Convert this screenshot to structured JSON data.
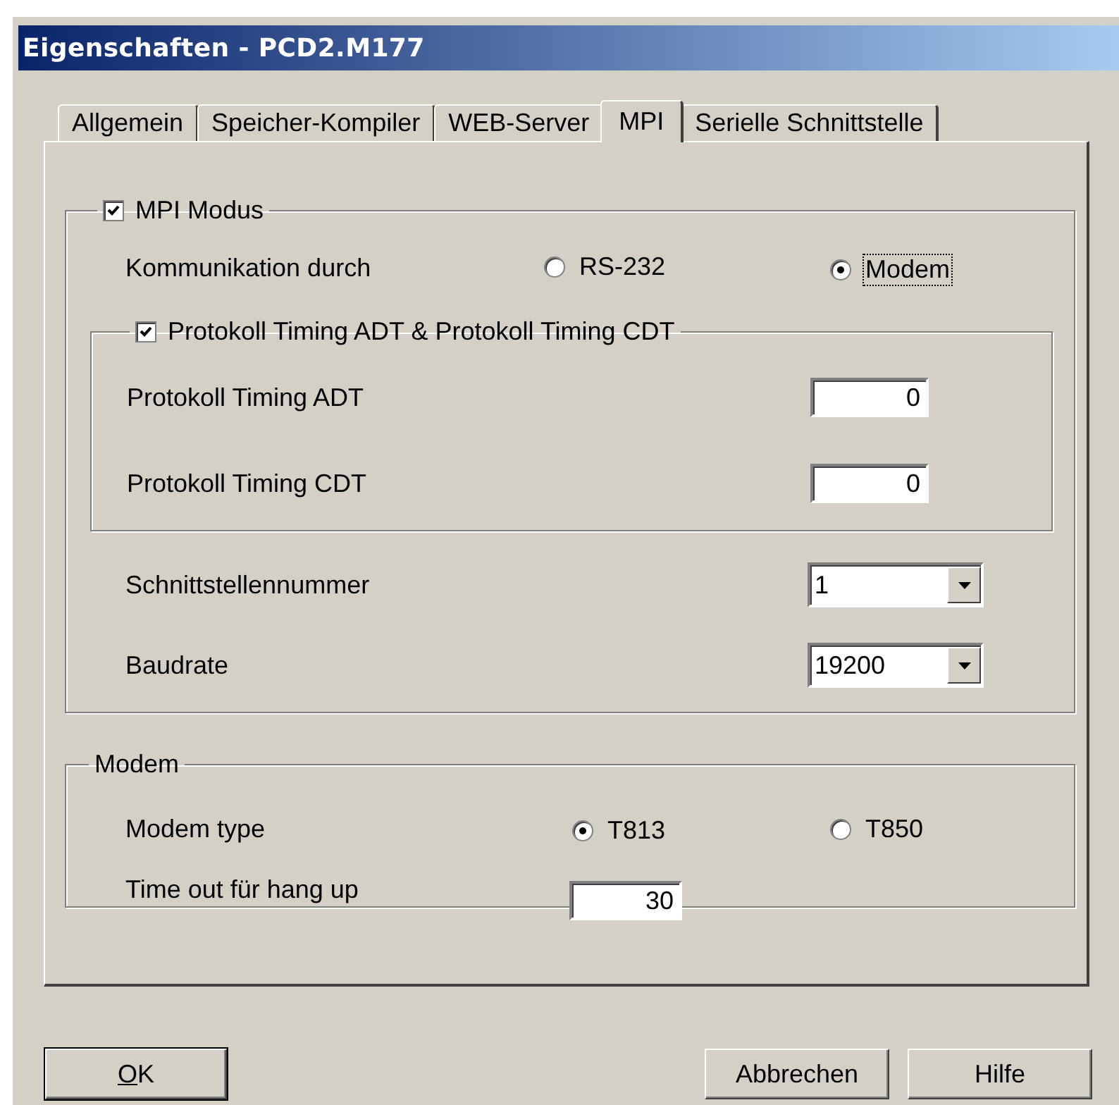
{
  "window": {
    "title": "Eigenschaften - PCD2.M177"
  },
  "tabs": [
    {
      "label": "Allgemein",
      "selected": false
    },
    {
      "label": "Speicher-Kompiler",
      "selected": false
    },
    {
      "label": "WEB-Server",
      "selected": false
    },
    {
      "label": "MPI",
      "selected": true
    },
    {
      "label": "Serielle Schnittstelle",
      "selected": false
    }
  ],
  "mpi_group": {
    "checkbox": {
      "label": "MPI Modus",
      "checked": true
    },
    "communication": {
      "label": "Kommunikation durch",
      "options": [
        {
          "label": "RS-232",
          "selected": false,
          "focused": false
        },
        {
          "label": "Modem",
          "selected": true,
          "focused": true
        }
      ]
    },
    "timing_group": {
      "checkbox": {
        "label": "Protokoll Timing ADT & Protokoll Timing CDT",
        "checked": true
      },
      "fields": [
        {
          "label": "Protokoll Timing ADT",
          "value": "0"
        },
        {
          "label": "Protokoll Timing CDT",
          "value": "0"
        }
      ]
    },
    "dropdowns": [
      {
        "label": "Schnittstellennummer",
        "value": "1"
      },
      {
        "label": "Baudrate",
        "value": "19200"
      }
    ]
  },
  "modem_group": {
    "title": "Modem",
    "modem_type": {
      "label": "Modem type",
      "options": [
        {
          "label": "T813",
          "selected": true
        },
        {
          "label": "T850",
          "selected": false
        }
      ]
    },
    "timeout": {
      "label": "Time out für hang up",
      "value": "30"
    }
  },
  "buttons": [
    {
      "label": "OK",
      "kind": "default",
      "mnemonic_underlined": true
    },
    {
      "label": "Abbrechen",
      "kind": "normal"
    },
    {
      "label": "Hilfe",
      "kind": "normal"
    }
  ]
}
